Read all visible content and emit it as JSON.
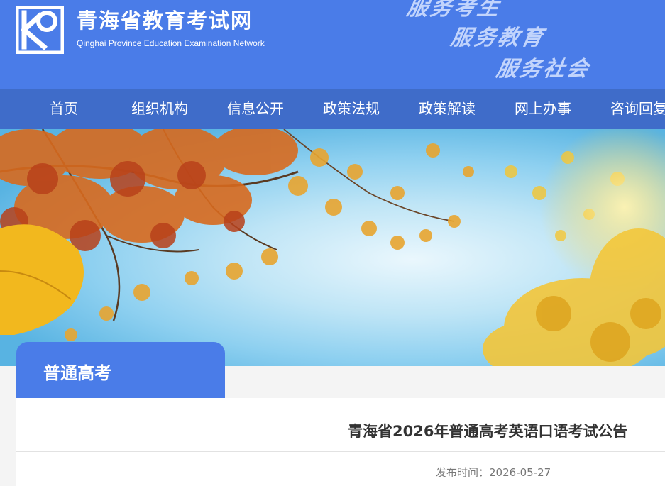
{
  "header": {
    "title": "青海省教育考试网",
    "subtitle": "Qinghai Province Education Examination Network",
    "slogans": [
      "服务考生",
      "服务教育",
      "服务社会"
    ]
  },
  "nav": {
    "items": [
      "首页",
      "组织机构",
      "信息公开",
      "政策法规",
      "政策解读",
      "网上办事",
      "咨询回复"
    ]
  },
  "section": {
    "tab_label": "普通高考"
  },
  "article": {
    "title": "青海省2026年普通高考英语口语考试公告",
    "publish_label": "发布时间：",
    "publish_date": "2026-05-27"
  },
  "colors": {
    "header_bg": "#4a7ce8",
    "nav_bg": "#3f6cc9",
    "tab_bg": "#4a7ce8"
  }
}
